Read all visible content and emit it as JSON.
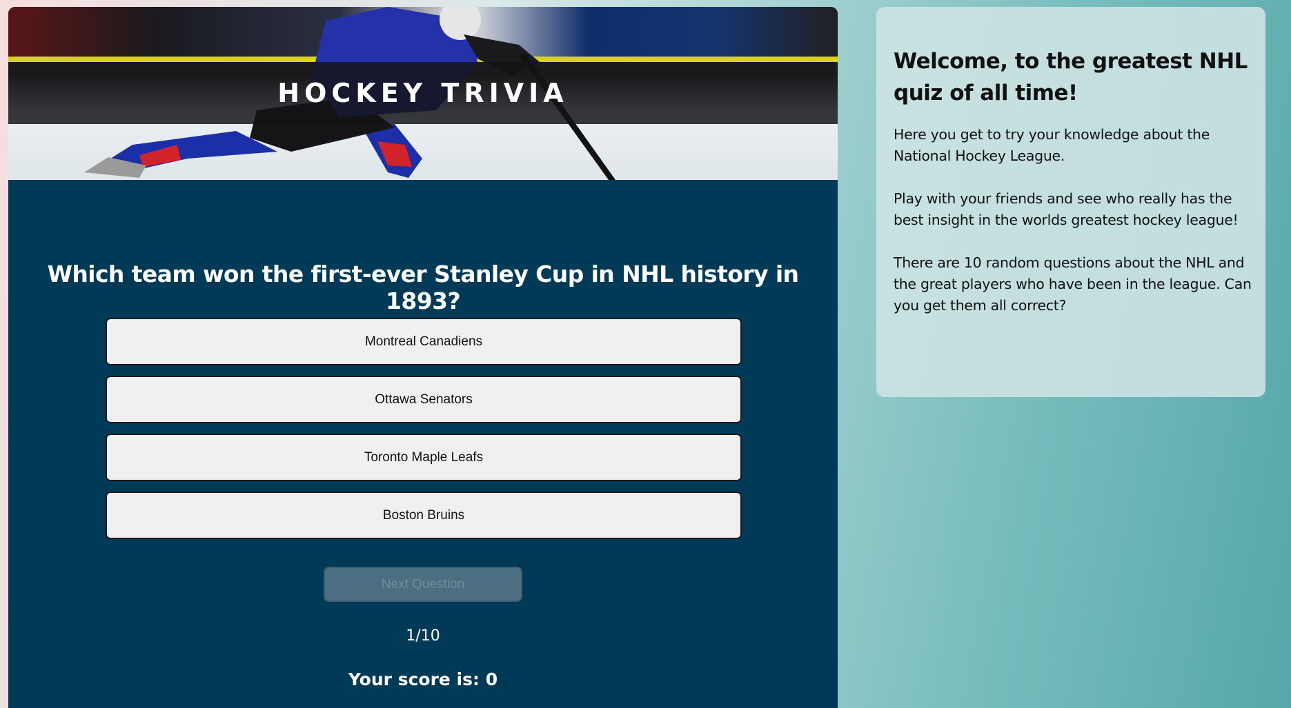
{
  "header": {
    "title": "HOCKEY TRIVIA"
  },
  "quiz": {
    "question": "Which team won the first-ever Stanley Cup in NHL history in 1893?",
    "answers": [
      "Montreal Canadiens",
      "Ottawa Senators",
      "Toronto Maple Leafs",
      "Boston Bruins"
    ],
    "next_label": "Next Question",
    "progress": "1/10",
    "score": "Your score is: 0"
  },
  "info": {
    "title": "Welcome, to the greatest NHL quiz of all time!",
    "paragraphs": [
      "Here you get to try your knowledge about the National Hockey League.",
      "Play with your friends and see who really has the best insight in the worlds greatest hockey league!",
      "There are 10 random questions about the NHL and the great players who have been in the league. Can you get them all correct?"
    ]
  },
  "colors": {
    "quiz_panel": "#003a57",
    "answer_button": "#f0f0f0",
    "next_button_disabled": "#4c6e81",
    "info_card": "#cfe4e4"
  }
}
